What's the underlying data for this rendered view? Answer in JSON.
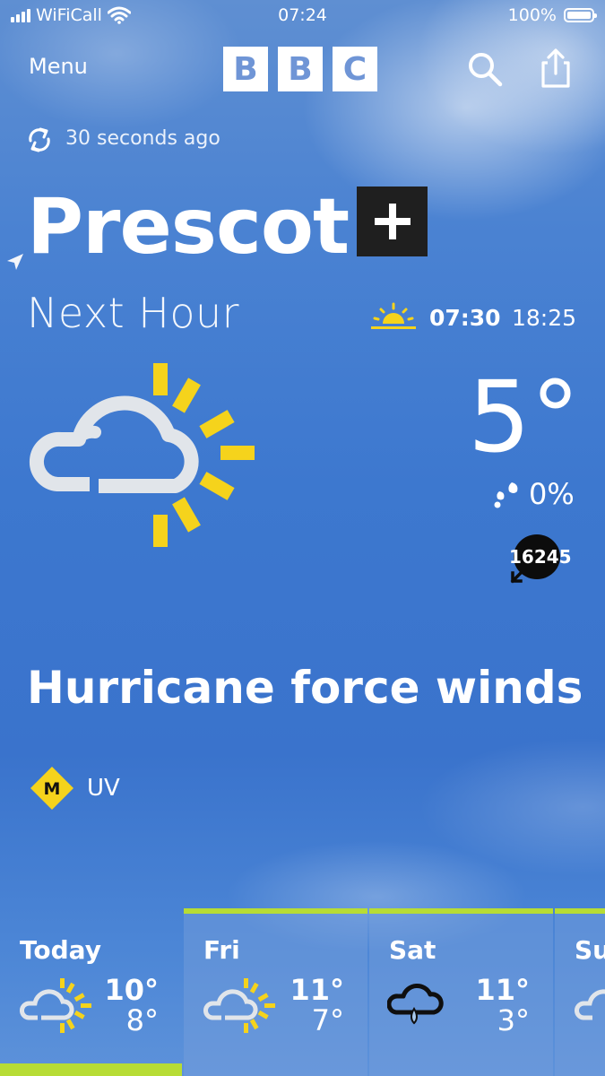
{
  "status_bar": {
    "carrier": "WiFiCall",
    "time": "07:24",
    "battery": "100%"
  },
  "header": {
    "menu_label": "Menu",
    "logo": [
      "B",
      "B",
      "C"
    ]
  },
  "updated": "30 seconds ago",
  "location": "Prescot",
  "section_title": "Next Hour",
  "sun": {
    "sunrise": "07:30",
    "sunset": "18:25"
  },
  "current": {
    "temperature": "5°",
    "precipitation": "0%",
    "wind_speed": "16245",
    "description": "Hurricane force winds",
    "uv_level": "M",
    "uv_label": "UV"
  },
  "forecast": [
    {
      "day": "Today",
      "high": "10°",
      "low": "8°",
      "icon": "sunny-intervals-icon"
    },
    {
      "day": "Fri",
      "high": "11°",
      "low": "7°",
      "icon": "sunny-intervals-icon"
    },
    {
      "day": "Sat",
      "high": "11°",
      "low": "3°",
      "icon": "light-rain-icon"
    },
    {
      "day": "Sun",
      "high": "",
      "low": "",
      "icon": "sunny-intervals-icon"
    }
  ],
  "colors": {
    "accent": "#b7dc35",
    "uv_moderate": "#f5d31c",
    "sun": "#f5d31c"
  }
}
